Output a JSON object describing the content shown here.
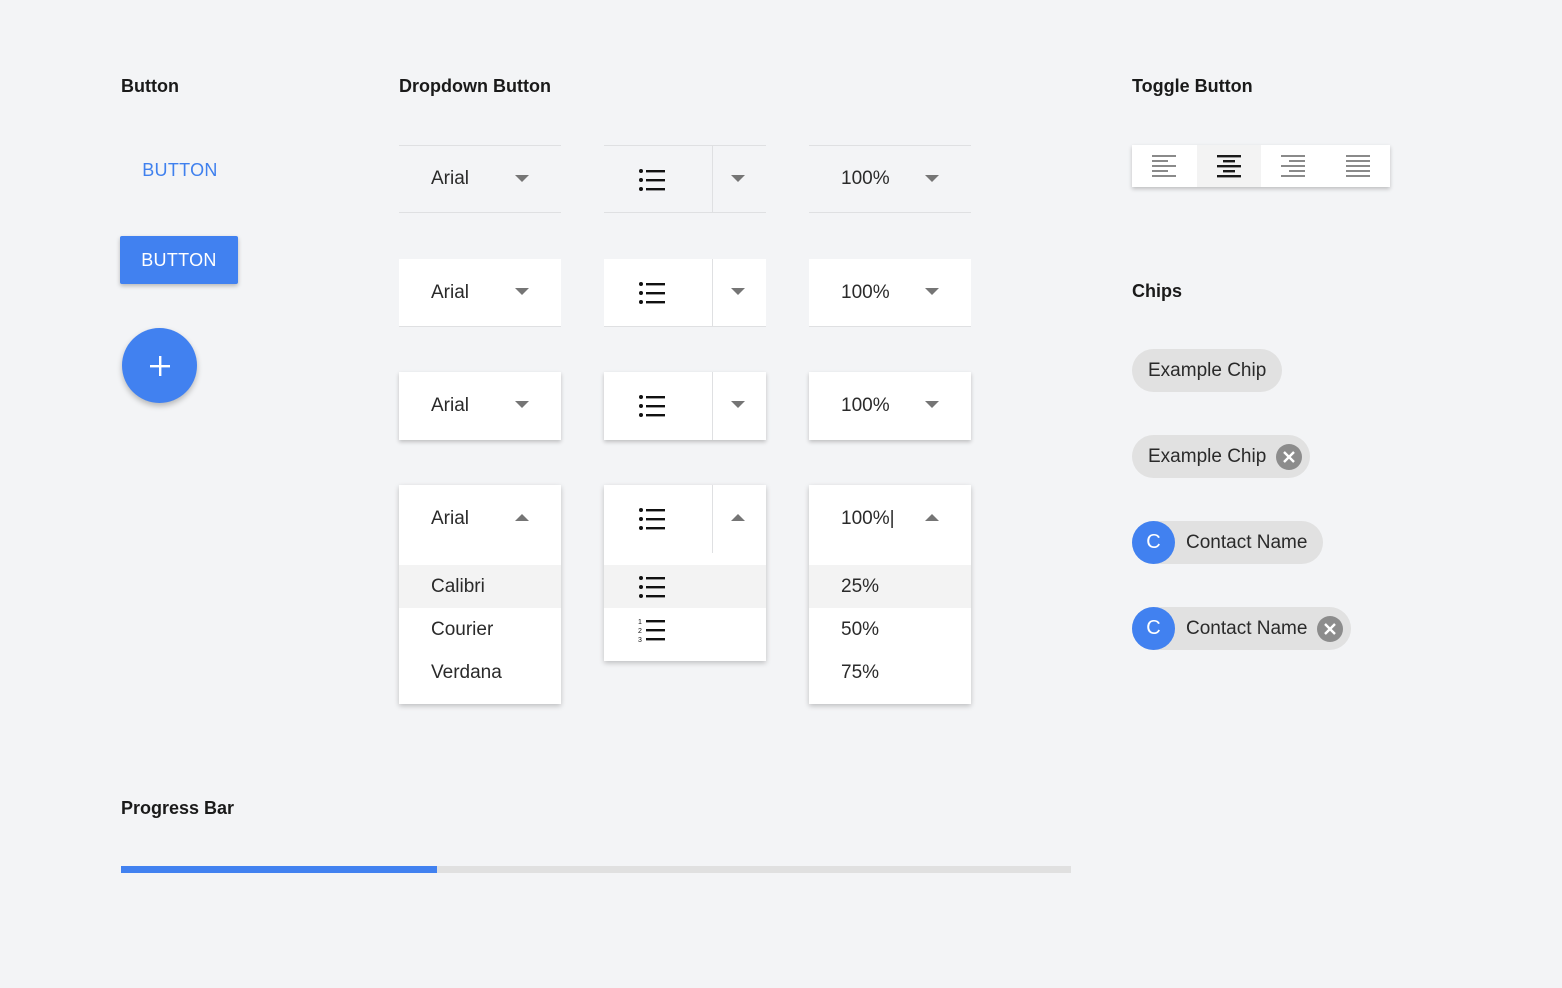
{
  "sections": {
    "button": "Button",
    "dropdown": "Dropdown Button",
    "toggle": "Toggle Button",
    "chips": "Chips",
    "progress": "Progress Bar"
  },
  "buttons": {
    "flat_label": "BUTTON",
    "raised_label": "BUTTON",
    "fab_icon": "plus-icon"
  },
  "dropdowns": {
    "font_value": "Arial",
    "zoom_value": "100%",
    "zoom_value_editing": "100%|",
    "list_icon": "bulleted-list-icon",
    "font_options": [
      "Calibri",
      "Courier",
      "Verdana"
    ],
    "list_options": [
      "bulleted-list-icon",
      "numbered-list-icon"
    ],
    "zoom_options": [
      "25%",
      "50%",
      "75%"
    ],
    "highlighted_index": 0
  },
  "toggle": {
    "items": [
      "align-left-icon",
      "align-center-icon",
      "align-right-icon",
      "align-justify-icon"
    ],
    "active_index": 1
  },
  "chips": [
    {
      "label": "Example Chip",
      "removable": false,
      "avatar": null
    },
    {
      "label": "Example Chip",
      "removable": true,
      "avatar": null
    },
    {
      "label": "Contact Name",
      "removable": false,
      "avatar": "C"
    },
    {
      "label": "Contact Name",
      "removable": true,
      "avatar": "C"
    }
  ],
  "progress": {
    "value": 0.333
  },
  "colors": {
    "accent": "#4181f0",
    "background": "#f3f4f6",
    "chip": "#e1e1e1"
  }
}
